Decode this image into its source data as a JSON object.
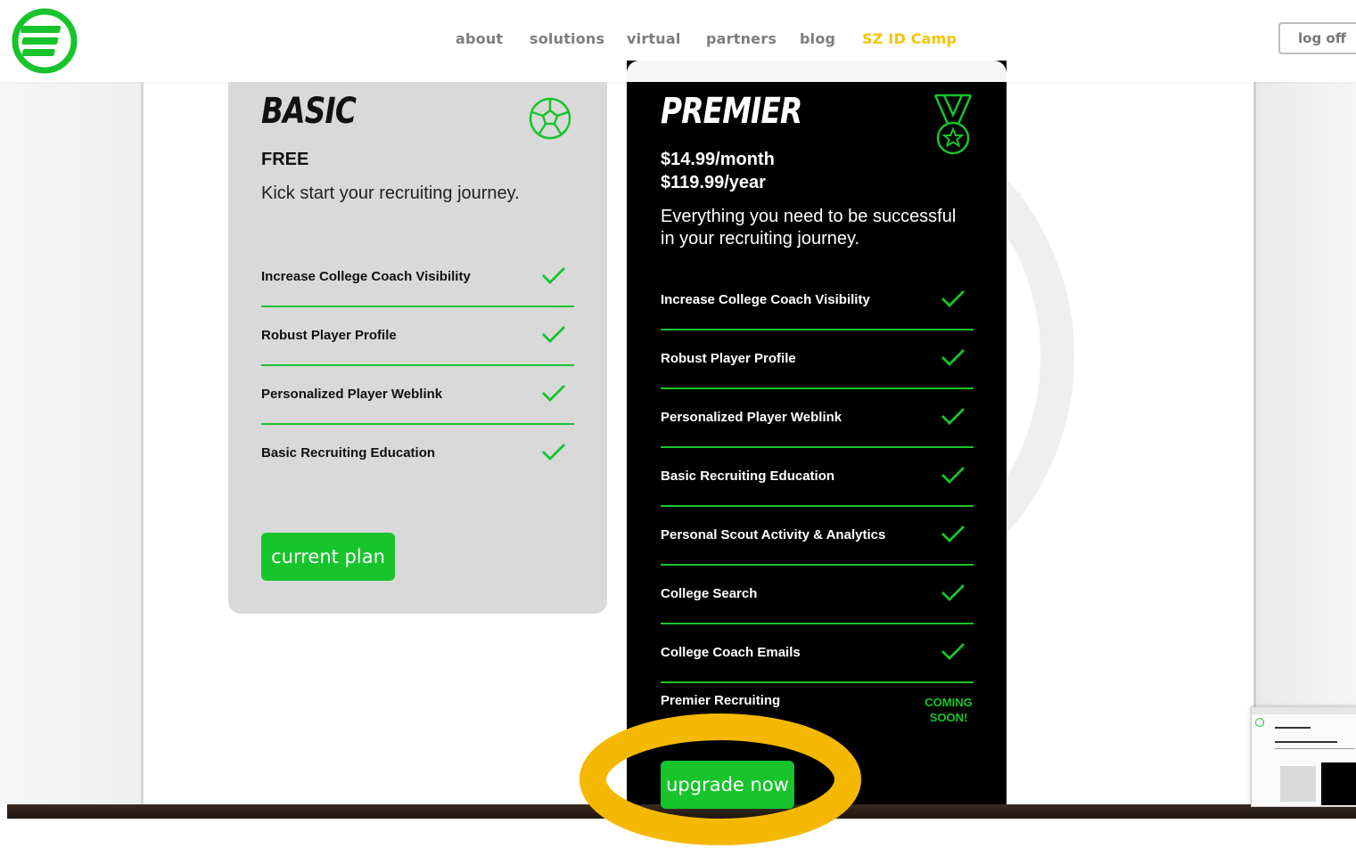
{
  "nav": {
    "items": [
      {
        "label": "about"
      },
      {
        "label": "solutions"
      },
      {
        "label": "virtual"
      },
      {
        "label": "partners"
      },
      {
        "label": "blog"
      },
      {
        "label": "SZ ID Camp"
      }
    ],
    "logoff_label": "log off",
    "highlight_color": "#f5c400"
  },
  "plans": {
    "basic": {
      "title": "BASIC",
      "price": "FREE",
      "description": "Kick start your recruiting journey.",
      "icon": "soccer-ball-icon",
      "features": [
        "Increase College Coach Visibility",
        "Robust Player Profile",
        "Personalized Player Weblink",
        "Basic Recruiting Education"
      ],
      "button_label": "current plan"
    },
    "premier": {
      "title": "PREMIER",
      "price_month": "$14.99/month",
      "price_year": "$119.99/year",
      "description_line1": "Everything you need to be successful",
      "description_line2": "in your recruiting journey.",
      "icon": "medal-icon",
      "features": [
        "Increase College Coach Visibility",
        "Robust Player Profile",
        "Personalized Player Weblink",
        "Basic Recruiting Education",
        "Personal Scout Activity & Analytics",
        "College Search",
        "College Coach Emails",
        "Premier Recruiting"
      ],
      "coming_soon_line1": "COMING",
      "coming_soon_line2": "SOON!",
      "button_label": "upgrade now"
    }
  },
  "colors": {
    "accent_green": "#17c42b",
    "premier_bg": "#000000",
    "basic_bg": "#d9d9d9",
    "annotation_yellow": "#f5b800"
  }
}
